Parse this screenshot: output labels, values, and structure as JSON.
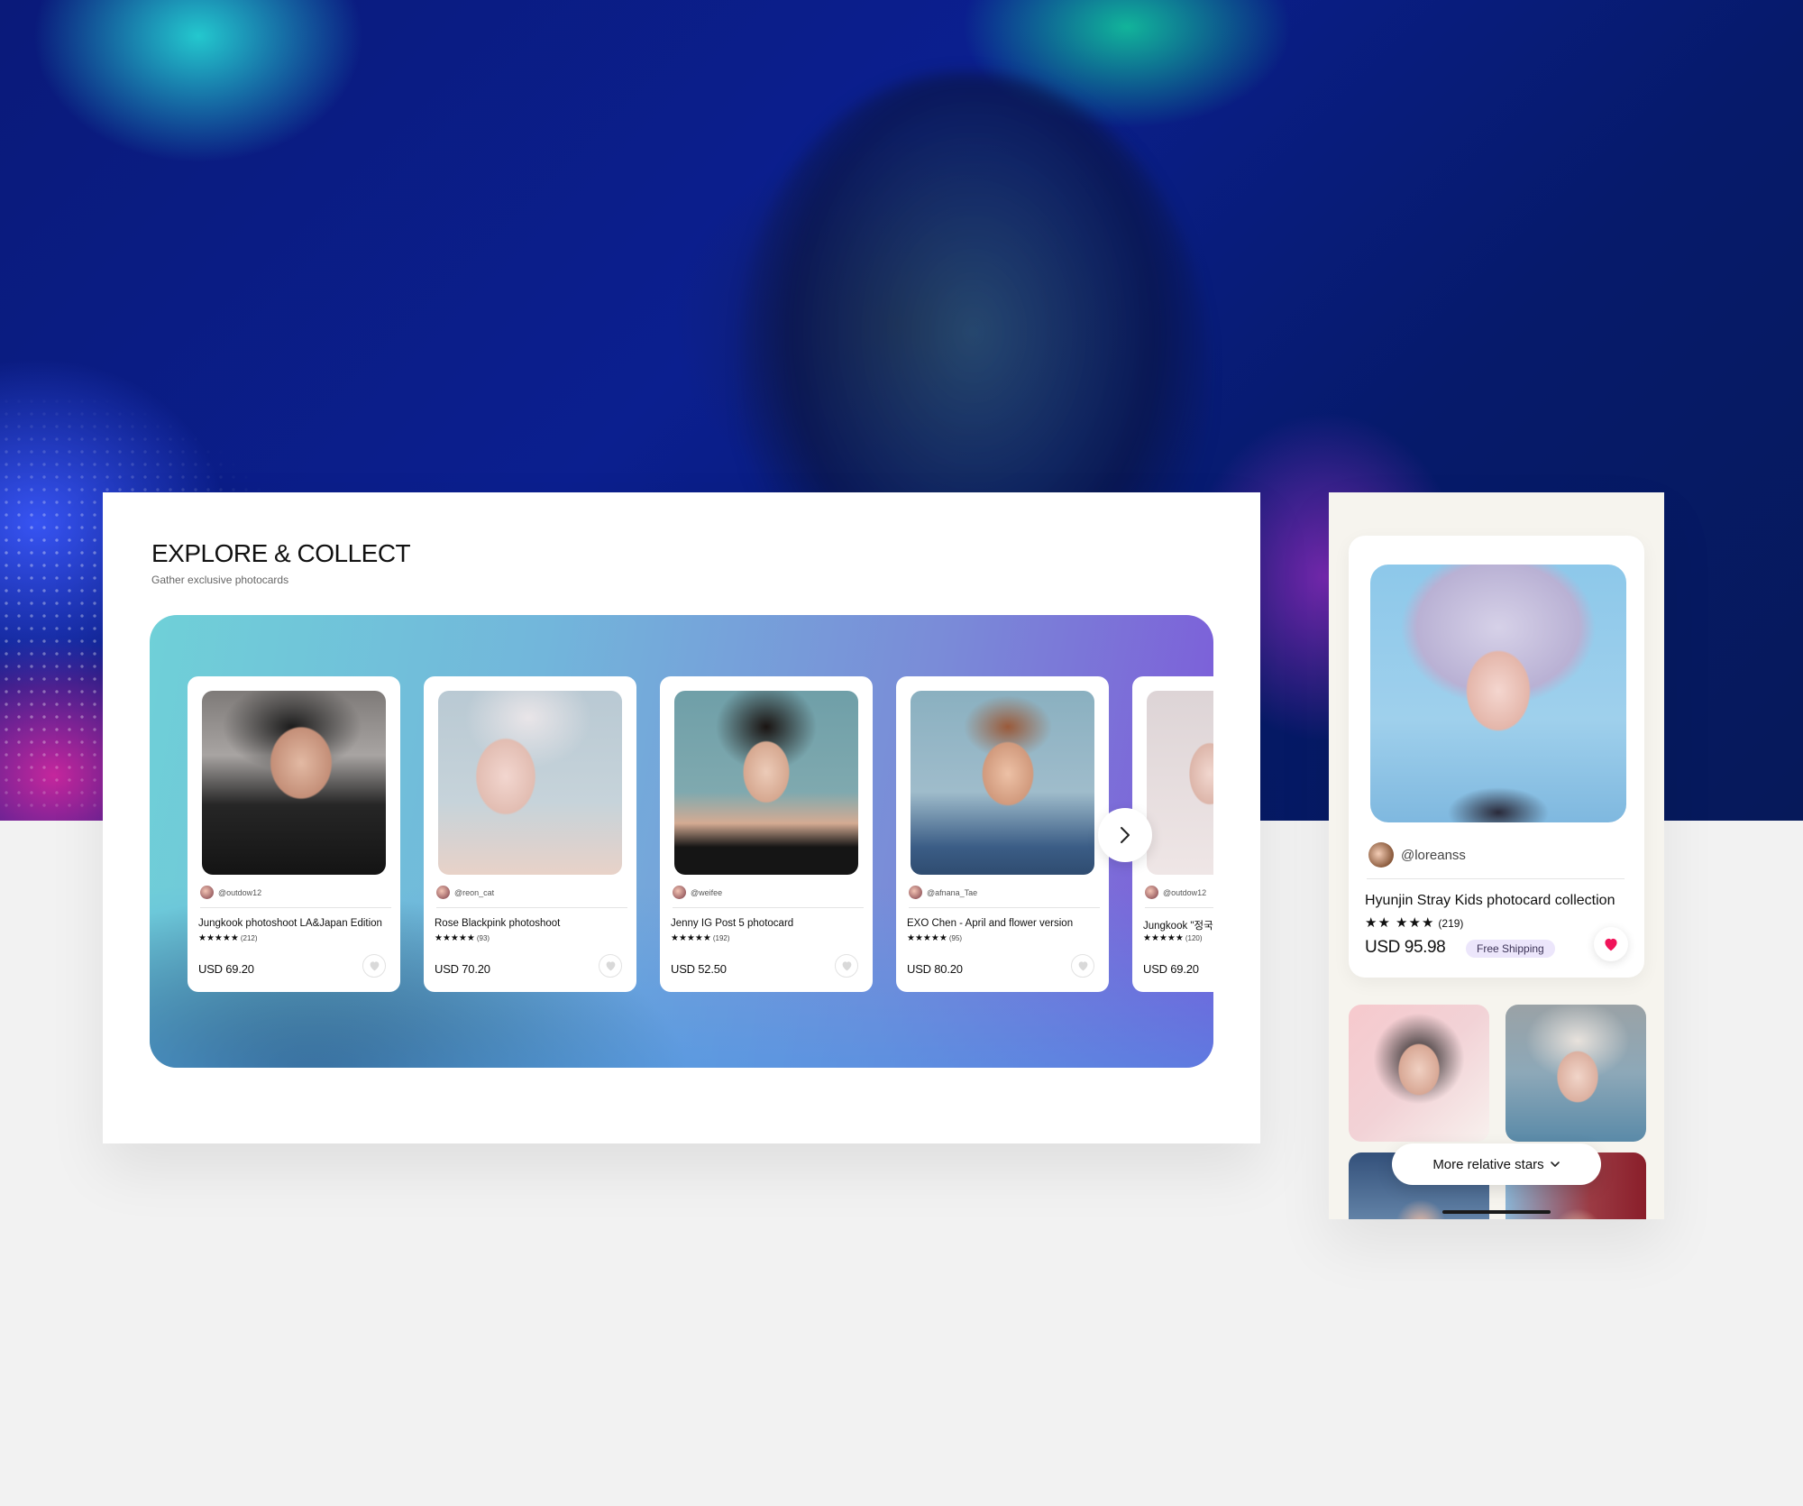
{
  "hero": {
    "description_icon": "concert-background"
  },
  "explore": {
    "title": "EXPLORE & COLLECT",
    "subtitle": "Gather exclusive photocards",
    "stars": "★★★★★",
    "cards": [
      {
        "user": "@outdow12",
        "name": "Jungkook photoshoot LA&Japan Edition",
        "rating_count": "(212)",
        "price": "USD 69.20"
      },
      {
        "user": "@reon_cat",
        "name": "Rose Blackpink photoshoot",
        "rating_count": "(93)",
        "price": "USD 70.20"
      },
      {
        "user": "@weifee",
        "name": "Jenny IG Post 5 photocard",
        "rating_count": "(192)",
        "price": "USD 52.50"
      },
      {
        "user": "@afnana_Tae",
        "name": "EXO Chen - April and flower version",
        "rating_count": "(95)",
        "price": "USD 80.20"
      },
      {
        "user": "@outdow12",
        "name": "Jungkook \"정국",
        "rating_count": "(120)",
        "price": "USD 69.20"
      }
    ],
    "next_icon": "chevron-right-icon"
  },
  "detail": {
    "user": "@loreanss",
    "name": "Hyunjin Stray Kids photocard collection",
    "stars": "★★ ★★★",
    "rating_count": "(219)",
    "price": "USD 95.98",
    "badge": "Free Shipping",
    "like_color": "#f0145a",
    "more_button": "More relative stars"
  },
  "colors": {
    "accent": "#7d57d9",
    "heart": "#f0145a"
  }
}
